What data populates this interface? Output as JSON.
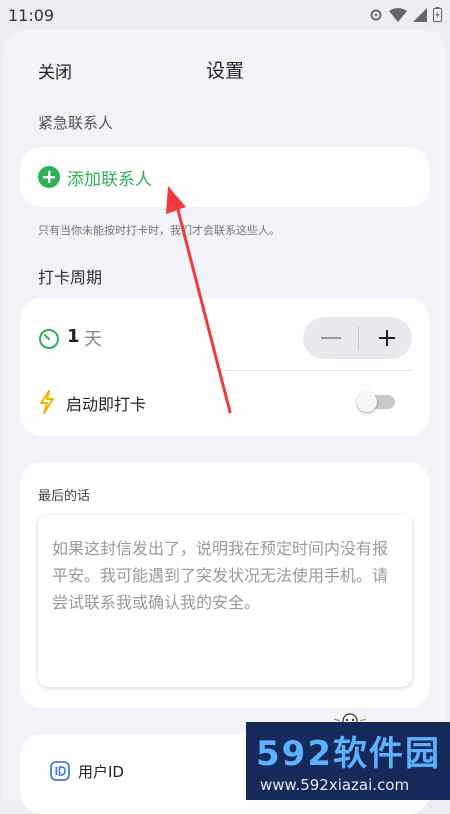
{
  "status_bar": {
    "time": "11:09"
  },
  "header": {
    "close_label": "关闭",
    "title": "设置"
  },
  "emergency": {
    "section_label": "紧急联系人",
    "add_label": "添加联系人",
    "hint": "只有当你未能按时打卡时，我们才会联系这些人。"
  },
  "checkin": {
    "section_label": "打卡周期",
    "days_value": "1",
    "days_unit": "天",
    "auto_checkin_label": "启动即打卡",
    "auto_checkin_enabled": false
  },
  "last_words": {
    "title": "最后的话",
    "placeholder": "如果这封信发出了，说明我在预定时间内没有报平安。我可能遇到了突发状况无法使用手机。请尝试联系我或确认我的安全。"
  },
  "user": {
    "id_label": "用户ID"
  },
  "watermark": {
    "brand": "592软件园",
    "url": "www.592xiazai.com"
  },
  "colors": {
    "accent_green": "#2fb257",
    "arrow_red": "#ef3b3b",
    "bolt_yellow": "#f4b400"
  }
}
